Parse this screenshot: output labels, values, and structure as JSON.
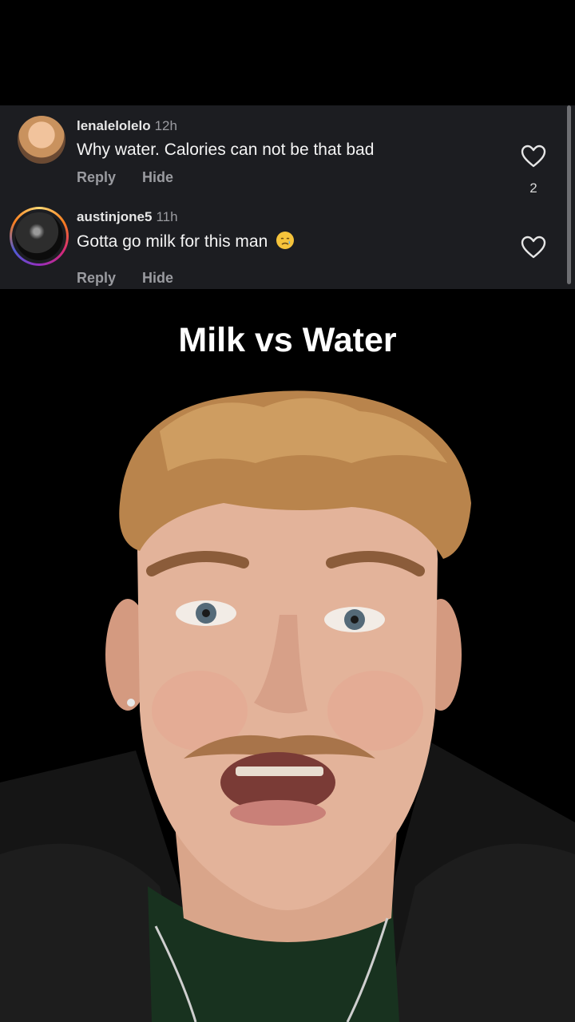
{
  "comments": [
    {
      "username": "lenalelolelo",
      "time": "12h",
      "text": "Why water. Calories can not be that bad",
      "reply_label": "Reply",
      "hide_label": "Hide",
      "likes": "2"
    },
    {
      "username": "austinjone5",
      "time": "11h",
      "text": "Gotta go milk for this man",
      "emoji": "crying-face",
      "reply_label": "Reply",
      "hide_label": "Hide",
      "likes": ""
    }
  ],
  "video": {
    "caption": "Milk vs Water"
  },
  "colors": {
    "overlay_bg": "#1c1d21",
    "muted_text": "#9a9ba0",
    "story_ring": [
      "#feda75",
      "#fa7e1e",
      "#d62976",
      "#962fbf",
      "#4f5bd5"
    ]
  }
}
